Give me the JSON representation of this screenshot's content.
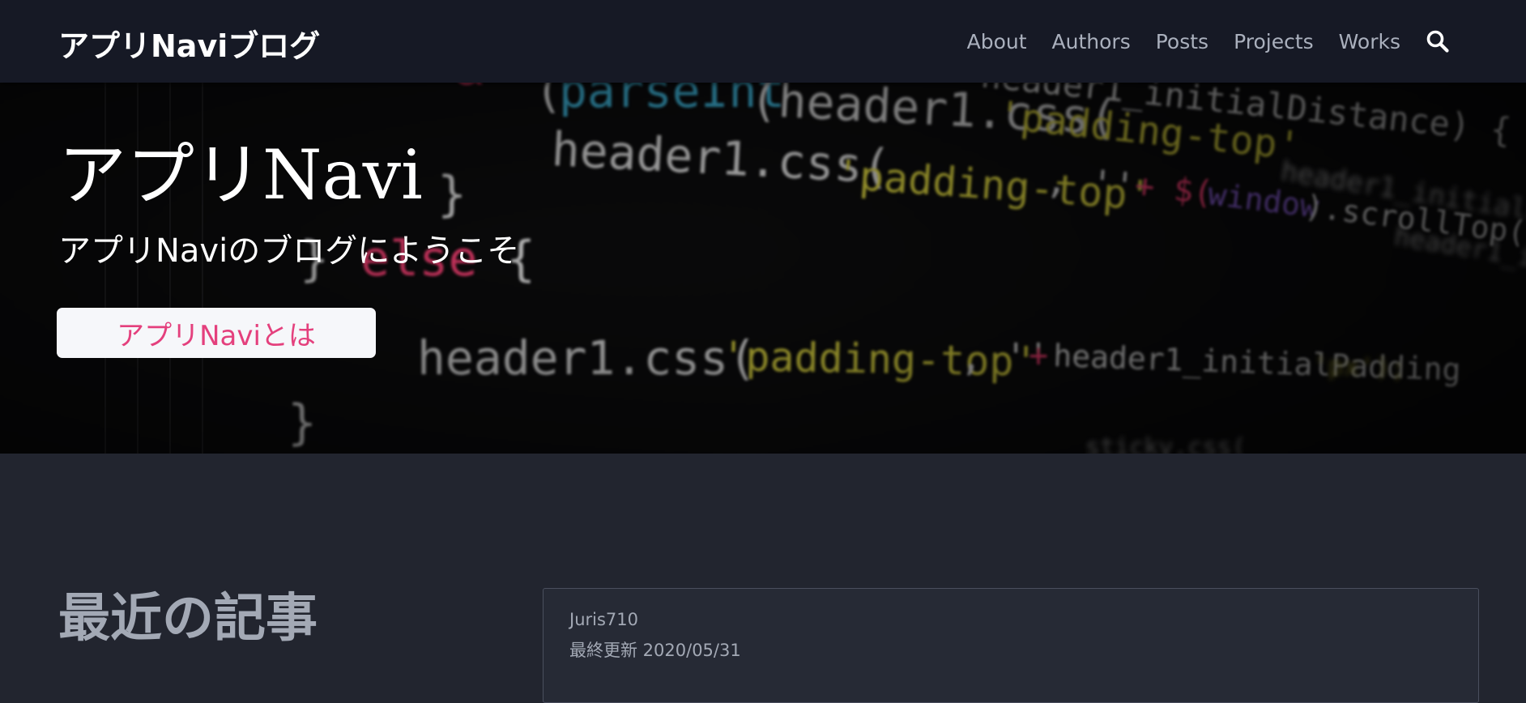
{
  "navbar": {
    "brand": "アプリNaviブログ",
    "links": [
      {
        "label": "About"
      },
      {
        "label": "Authors"
      },
      {
        "label": "Posts"
      },
      {
        "label": "Projects"
      },
      {
        "label": "Works"
      }
    ],
    "search_icon": "search-icon"
  },
  "hero": {
    "title": "アプリNavi",
    "subtitle": "アプリNaviのブログにようこそ",
    "button_label": "アプリNaviとは",
    "background": "code-screen-photo"
  },
  "main": {
    "recent_heading": "最近の記事",
    "posts": [
      {
        "author": "Juris710",
        "updated": "最終更新 2020/05/31"
      }
    ]
  },
  "colors": {
    "navbar_bg": "#161925",
    "page_bg": "#22252f",
    "accent": "#e4407d",
    "muted_text": "#a3a9b5"
  }
}
